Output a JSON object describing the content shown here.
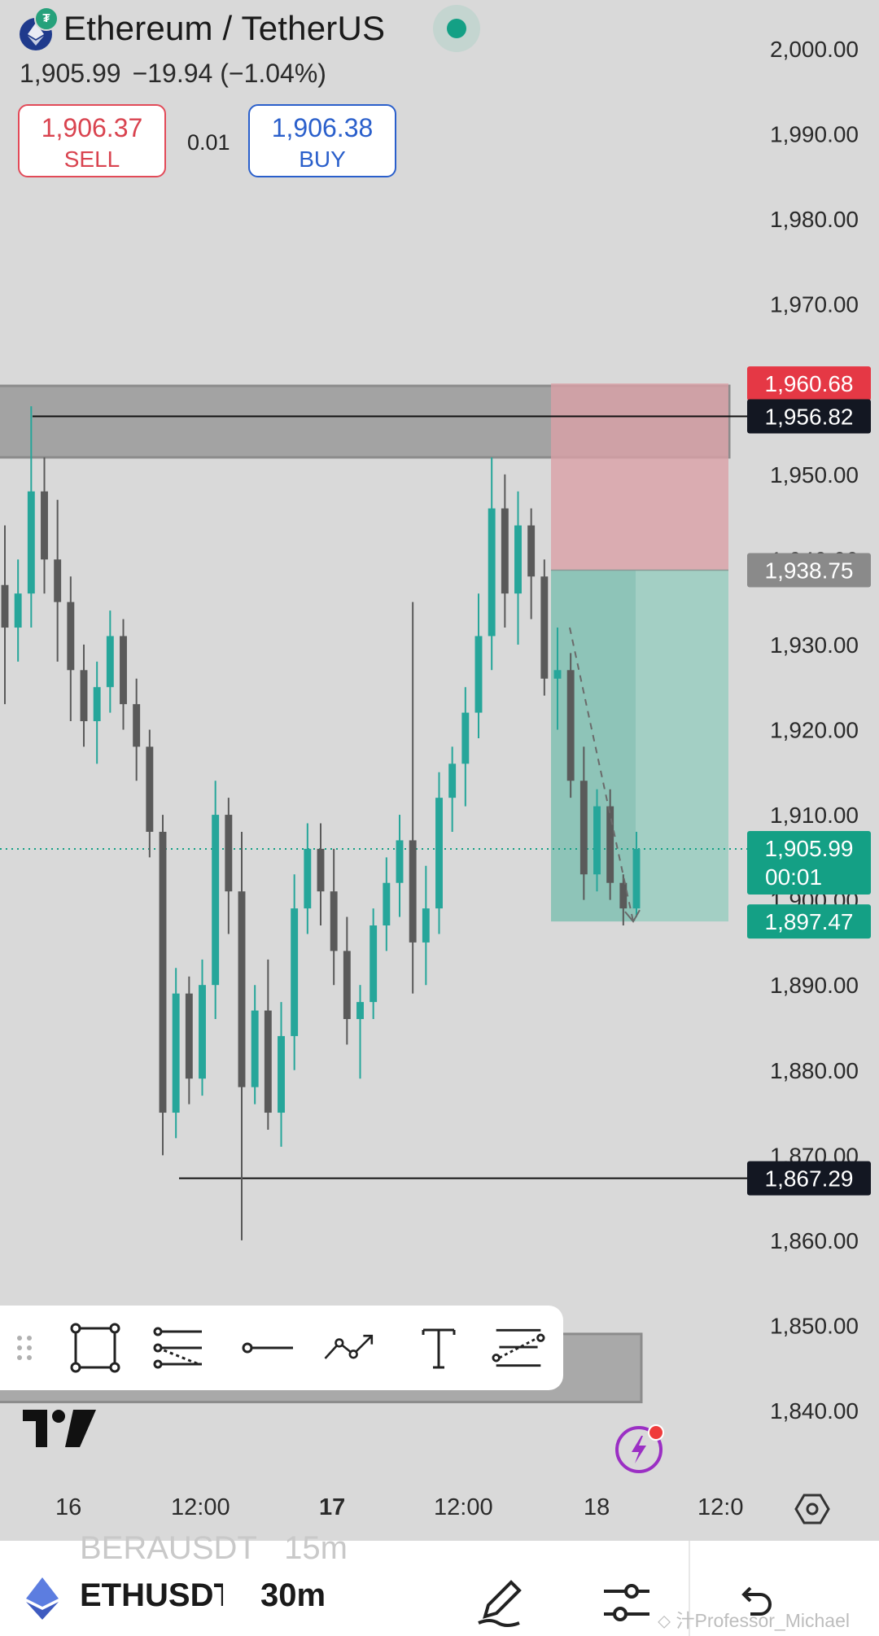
{
  "header": {
    "title": "Ethereum / TetherUS",
    "last_price": "1,905.99",
    "change": "−19.94 (−1.04%)",
    "sell_price": "1,906.37",
    "sell_label": "SELL",
    "buy_price": "1,906.38",
    "buy_label": "BUY",
    "spread": "0.01",
    "status_icon": "market-open-dot"
  },
  "colors": {
    "up": "#26a69a",
    "down": "#5a5a5a",
    "sell": "#d9434f",
    "buy": "#2a5fcb",
    "stop_zone": "#d9a0a6",
    "target_zone": "#a3cfc4",
    "resistance_box": "#a3a3a3"
  },
  "chart_data": {
    "type": "candlestick",
    "symbol": "ETHUSDT",
    "interval": "30m",
    "ylim": [
      1835,
      2005
    ],
    "y_ticks": [
      "2,000.00",
      "1,990.00",
      "1,980.00",
      "1,970.00",
      "1,960.00",
      "1,950.00",
      "1,940.00",
      "1,930.00",
      "1,920.00",
      "1,910.00",
      "1,900.00",
      "1,890.00",
      "1,880.00",
      "1,870.00",
      "1,860.00",
      "1,850.00",
      "1,840.00"
    ],
    "x_ticks": [
      {
        "label": "16",
        "bold": false
      },
      {
        "label": "12:00",
        "bold": false
      },
      {
        "label": "17",
        "bold": true
      },
      {
        "label": "12:00",
        "bold": false
      },
      {
        "label": "18",
        "bold": false
      },
      {
        "label": "12:0",
        "bold": false
      }
    ],
    "price_tags": [
      {
        "label": "1,960.68",
        "value": 1960.68,
        "color": "#e53845"
      },
      {
        "label": "1,956.82",
        "value": 1956.82,
        "color": "#131722"
      },
      {
        "label": "1,938.75",
        "value": 1938.75,
        "color": "#8a8a8a"
      },
      {
        "label": "1,905.99",
        "sub": "00:01",
        "value": 1905.99,
        "color": "#14a085"
      },
      {
        "label": "1,897.47",
        "value": 1897.47,
        "color": "#14a085"
      },
      {
        "label": "1,867.29",
        "value": 1867.29,
        "color": "#131722"
      }
    ],
    "horizontal_lines": [
      1956.82,
      1867.29
    ],
    "last_price": 1905.99,
    "resistance_zone": [
      1952,
      1960.4
    ],
    "short_position": {
      "entry": 1938.75,
      "stop": 1960.68,
      "target": 1897.47
    },
    "projection_path": [
      1932,
      1897.47
    ],
    "candles": [
      [
        1937,
        1944,
        1923,
        1932
      ],
      [
        1932,
        1940,
        1928,
        1936
      ],
      [
        1936,
        1958,
        1932,
        1948
      ],
      [
        1948,
        1952,
        1936,
        1940
      ],
      [
        1940,
        1947,
        1928,
        1935
      ],
      [
        1935,
        1938,
        1921,
        1927
      ],
      [
        1927,
        1930,
        1918,
        1921
      ],
      [
        1921,
        1928,
        1916,
        1925
      ],
      [
        1925,
        1934,
        1922,
        1931
      ],
      [
        1931,
        1933,
        1920,
        1923
      ],
      [
        1923,
        1926,
        1914,
        1918
      ],
      [
        1918,
        1920,
        1905,
        1908
      ],
      [
        1908,
        1910,
        1870,
        1875
      ],
      [
        1875,
        1892,
        1872,
        1889
      ],
      [
        1889,
        1891,
        1876,
        1879
      ],
      [
        1879,
        1893,
        1877,
        1890
      ],
      [
        1890,
        1914,
        1886,
        1910
      ],
      [
        1910,
        1912,
        1896,
        1901
      ],
      [
        1901,
        1908,
        1860,
        1878
      ],
      [
        1878,
        1890,
        1876,
        1887
      ],
      [
        1887,
        1893,
        1873,
        1875
      ],
      [
        1875,
        1888,
        1871,
        1884
      ],
      [
        1884,
        1903,
        1880,
        1899
      ],
      [
        1899,
        1909,
        1896,
        1906
      ],
      [
        1906,
        1909,
        1897,
        1901
      ],
      [
        1901,
        1906,
        1890,
        1894
      ],
      [
        1894,
        1898,
        1883,
        1886
      ],
      [
        1886,
        1890,
        1879,
        1888
      ],
      [
        1888,
        1899,
        1886,
        1897
      ],
      [
        1897,
        1905,
        1894,
        1902
      ],
      [
        1902,
        1910,
        1898,
        1907
      ],
      [
        1907,
        1935,
        1889,
        1895
      ],
      [
        1895,
        1904,
        1890,
        1899
      ],
      [
        1899,
        1915,
        1896,
        1912
      ],
      [
        1912,
        1918,
        1908,
        1916
      ],
      [
        1916,
        1925,
        1911,
        1922
      ],
      [
        1922,
        1936,
        1919,
        1931
      ],
      [
        1931,
        1952,
        1927,
        1946
      ],
      [
        1946,
        1950,
        1932,
        1936
      ],
      [
        1936,
        1948,
        1930,
        1944
      ],
      [
        1944,
        1946,
        1933,
        1938
      ],
      [
        1938,
        1940,
        1924,
        1926
      ],
      [
        1926,
        1932,
        1920,
        1927
      ],
      [
        1927,
        1929,
        1912,
        1914
      ],
      [
        1914,
        1918,
        1900,
        1903
      ],
      [
        1903,
        1913,
        1901,
        1911
      ],
      [
        1911,
        1913,
        1900,
        1902
      ],
      [
        1902,
        1903,
        1897,
        1899
      ],
      [
        1899,
        1908,
        1898,
        1906
      ]
    ]
  },
  "toolbar": {
    "tools": [
      {
        "name": "drag-handle-icon"
      },
      {
        "name": "rectangle-tool-icon"
      },
      {
        "name": "fib-retracement-icon"
      },
      {
        "name": "horizontal-line-icon"
      },
      {
        "name": "trend-line-icon"
      },
      {
        "name": "text-tool-icon"
      },
      {
        "name": "parallel-channel-icon"
      }
    ]
  },
  "bottom_bar": {
    "symbol": "ETHUSDT",
    "interval": "30m",
    "ghost_symbol": "BERAUSDT",
    "ghost_interval": "15m",
    "watermark": "Professor_Michael"
  }
}
